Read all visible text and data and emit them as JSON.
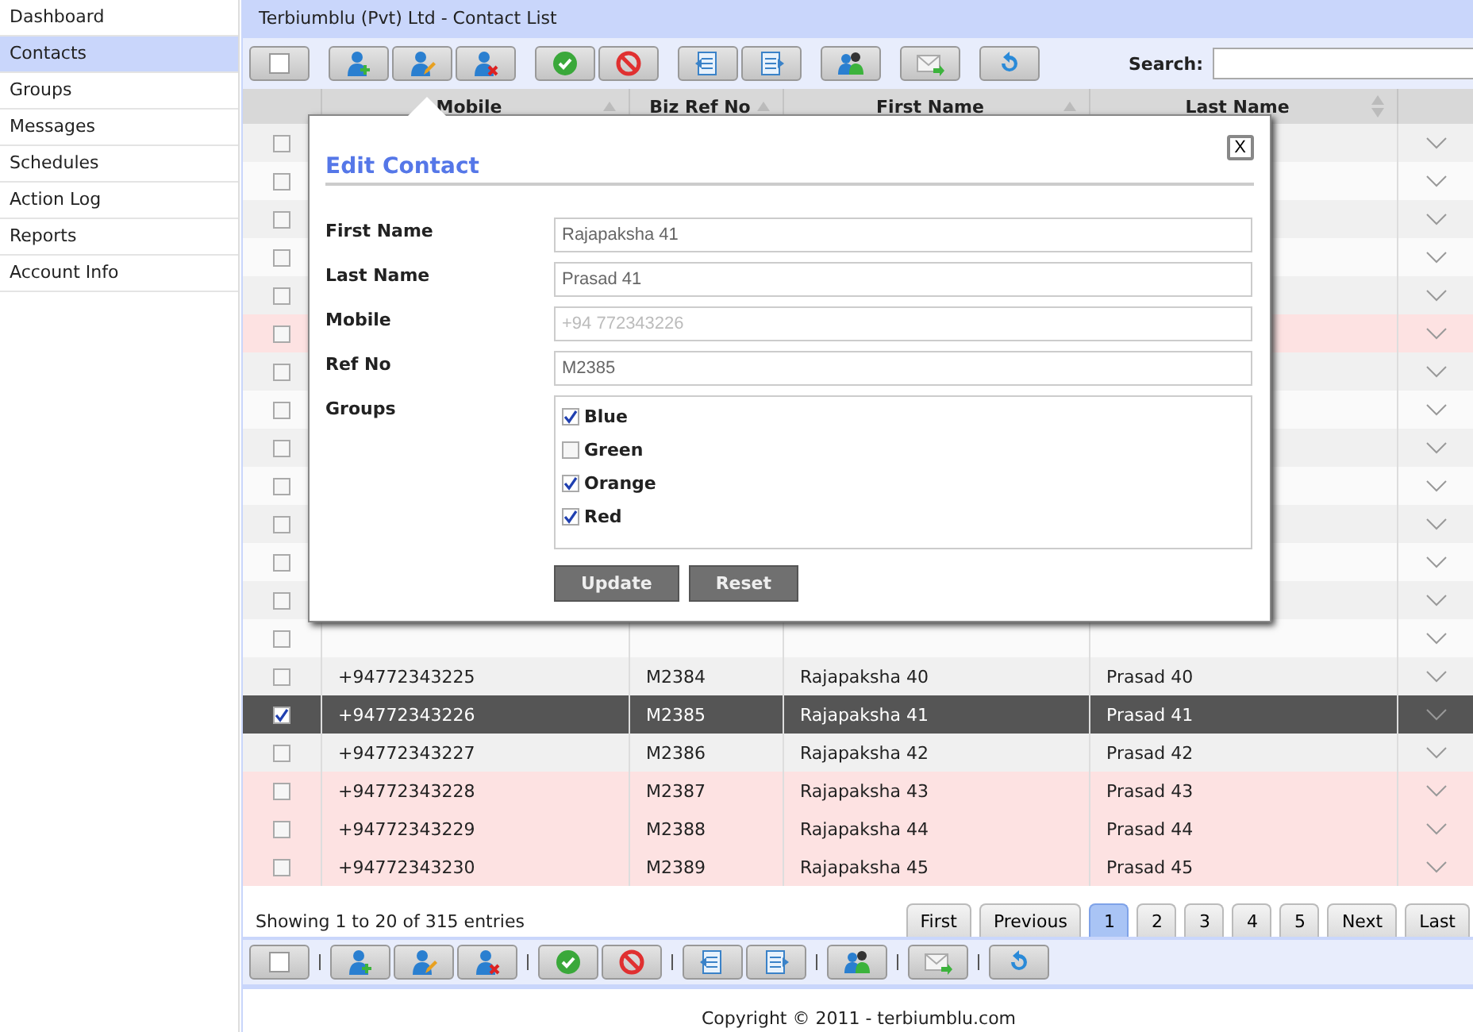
{
  "sidebar": {
    "items": [
      {
        "label": "Dashboard",
        "selected": false
      },
      {
        "label": "Contacts",
        "selected": true
      },
      {
        "label": "Groups",
        "selected": false
      },
      {
        "label": "Messages",
        "selected": false
      },
      {
        "label": "Schedules",
        "selected": false
      },
      {
        "label": "Action Log",
        "selected": false
      },
      {
        "label": "Reports",
        "selected": false
      },
      {
        "label": "Account Info",
        "selected": false
      }
    ]
  },
  "title": "Terbiumblu (Pvt) Ltd - Contact List",
  "search": {
    "label": "Search:"
  },
  "table": {
    "columns": [
      {
        "label": "Mobile",
        "sort_both": false
      },
      {
        "label": "Biz Ref No",
        "sort_both": false
      },
      {
        "label": "First Name",
        "sort_both": false
      },
      {
        "label": "Last Name",
        "sort_both": true
      }
    ],
    "rows": [
      {
        "checked": false,
        "flagged": false,
        "selected": false
      },
      {
        "checked": false,
        "flagged": false,
        "selected": false
      },
      {
        "checked": false,
        "flagged": false,
        "selected": false
      },
      {
        "checked": false,
        "flagged": false,
        "selected": false
      },
      {
        "checked": false,
        "flagged": false,
        "selected": false
      },
      {
        "checked": false,
        "flagged": true,
        "selected": false
      },
      {
        "checked": false,
        "flagged": false,
        "selected": false
      },
      {
        "checked": false,
        "flagged": false,
        "selected": false
      },
      {
        "checked": false,
        "flagged": false,
        "selected": false
      },
      {
        "checked": false,
        "flagged": false,
        "selected": false
      },
      {
        "checked": false,
        "flagged": false,
        "selected": false
      },
      {
        "checked": false,
        "flagged": false,
        "selected": false
      },
      {
        "checked": false,
        "flagged": false,
        "selected": false
      },
      {
        "checked": false,
        "flagged": false,
        "selected": false
      },
      {
        "checked": false,
        "flagged": false,
        "selected": false,
        "cells": [
          "+94772343225",
          "M2384",
          "Rajapaksha 40",
          "Prasad 40"
        ]
      },
      {
        "checked": true,
        "flagged": false,
        "selected": true,
        "cells": [
          "+94772343226",
          "M2385",
          "Rajapaksha 41",
          "Prasad 41"
        ]
      },
      {
        "checked": false,
        "flagged": false,
        "selected": false,
        "cells": [
          "+94772343227",
          "M2386",
          "Rajapaksha 42",
          "Prasad 42"
        ]
      },
      {
        "checked": false,
        "flagged": true,
        "selected": false,
        "cells": [
          "+94772343228",
          "M2387",
          "Rajapaksha 43",
          "Prasad 43"
        ]
      },
      {
        "checked": false,
        "flagged": true,
        "selected": false,
        "cells": [
          "+94772343229",
          "M2388",
          "Rajapaksha 44",
          "Prasad 44"
        ]
      },
      {
        "checked": false,
        "flagged": true,
        "selected": false,
        "cells": [
          "+94772343230",
          "M2389",
          "Rajapaksha 45",
          "Prasad 45"
        ]
      }
    ]
  },
  "info": "Showing 1 to 20 of 315 entries",
  "pagination": [
    {
      "label": "First",
      "selected": false
    },
    {
      "label": "Previous",
      "selected": false
    },
    {
      "label": "1",
      "selected": true
    },
    {
      "label": "2",
      "selected": false
    },
    {
      "label": "3",
      "selected": false
    },
    {
      "label": "4",
      "selected": false
    },
    {
      "label": "5",
      "selected": false
    },
    {
      "label": "Next",
      "selected": false
    },
    {
      "label": "Last",
      "selected": false
    }
  ],
  "dialog": {
    "title": "Edit Contact",
    "close": "X",
    "fields": [
      {
        "label": "First Name",
        "value": "Rajapaksha 41"
      },
      {
        "label": "Last Name",
        "value": "Prasad 41"
      },
      {
        "label": "Mobile",
        "value": "+94 772343226",
        "blurred": true
      },
      {
        "label": "Ref No",
        "value": "M2385"
      }
    ],
    "groups_label": "Groups",
    "groups": [
      {
        "label": "Blue",
        "checked": true
      },
      {
        "label": "Green",
        "checked": false
      },
      {
        "label": "Orange",
        "checked": true
      },
      {
        "label": "Red",
        "checked": true
      }
    ],
    "buttons": [
      "Update",
      "Reset"
    ]
  },
  "copyright": "Copyright © 2011 - terbiumblu.com"
}
